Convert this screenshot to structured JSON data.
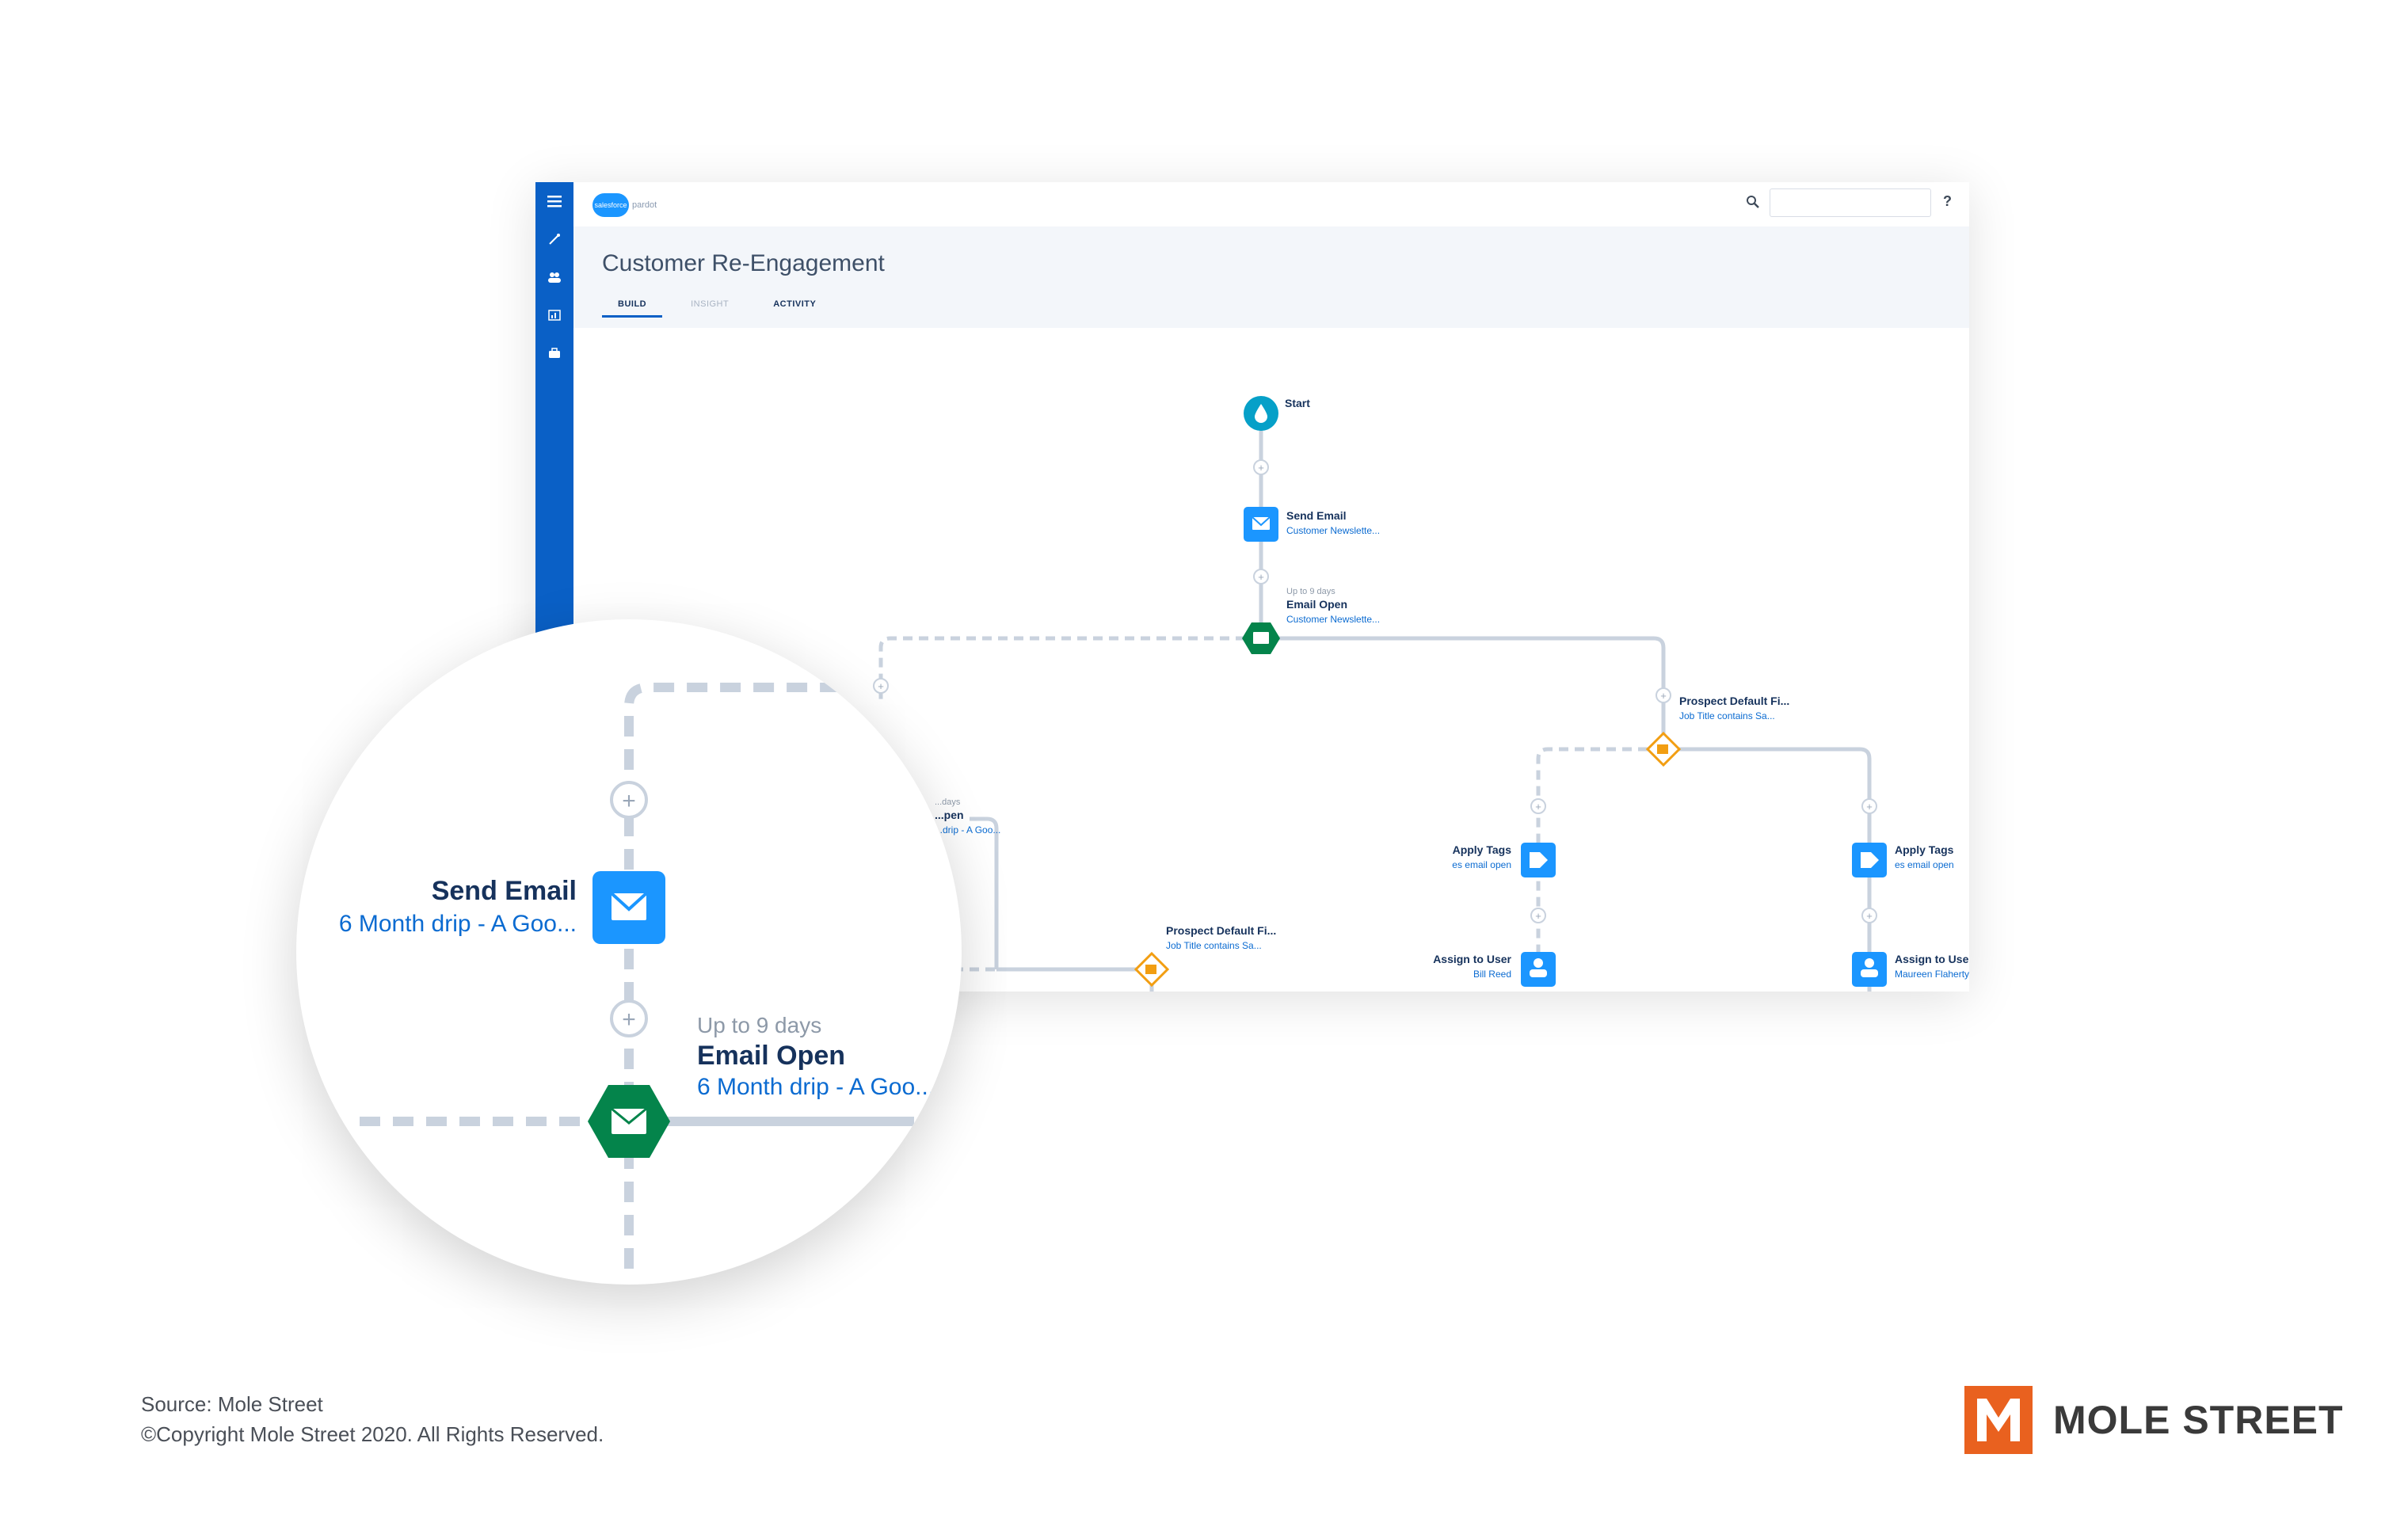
{
  "app": {
    "logo_text": "salesforce",
    "product": "pardot",
    "search_placeholder": "",
    "help_label": "?",
    "rail_icons": [
      "menu-icon",
      "wand-icon",
      "people-icon",
      "report-icon",
      "briefcase-icon"
    ]
  },
  "page": {
    "title": "Customer Re-Engagement",
    "tabs": [
      {
        "label": "BUILD",
        "active": true
      },
      {
        "label": "INSIGHT",
        "active": false
      },
      {
        "label": "ACTIVITY",
        "active": false
      }
    ]
  },
  "flow": {
    "start_label": "Start",
    "send_email": {
      "title": "Send Email",
      "subtitle": "Customer Newslette..."
    },
    "email_open": {
      "wait": "Up to 9 days",
      "title": "Email Open",
      "subtitle": "Customer Newslette..."
    },
    "left_branch": {
      "wait": "...days",
      "title": "...pen",
      "subtitle": "...drip - A Goo..."
    },
    "rule_left": {
      "title": "Prospect Default Fi...",
      "subtitle": "Job Title contains Sa..."
    },
    "rule_right": {
      "title": "Prospect Default Fi...",
      "subtitle": "Job Title contains Sa..."
    },
    "apply_tags_left": {
      "title": "Apply Tags",
      "subtitle": "es email open"
    },
    "apply_tags_right": {
      "title": "Apply Tags",
      "subtitle": "es email open"
    },
    "assign_left": {
      "title": "Assign to User",
      "subtitle": "Bill Reed"
    },
    "assign_right": {
      "title": "Assign to User",
      "subtitle": "Maureen Flaherty"
    }
  },
  "zoom": {
    "send_email": {
      "title": "Send Email",
      "subtitle": "6 Month drip - A Goo..."
    },
    "email_open": {
      "wait": "Up to 9 days",
      "title": "Email Open",
      "subtitle": "6 Month drip - A Goo..."
    }
  },
  "colors": {
    "rail": "#0a60c6",
    "action_node": "#1b96ff",
    "trigger_node": "#04844b",
    "start_node": "#06a0c8",
    "rule_node": "#f29e12",
    "connector": "#c9d2de"
  },
  "footer": {
    "source": "Source: Mole Street",
    "copyright": "©Copyright Mole Street 2020. All Rights Reserved.",
    "brand": "MOLE STREET"
  }
}
